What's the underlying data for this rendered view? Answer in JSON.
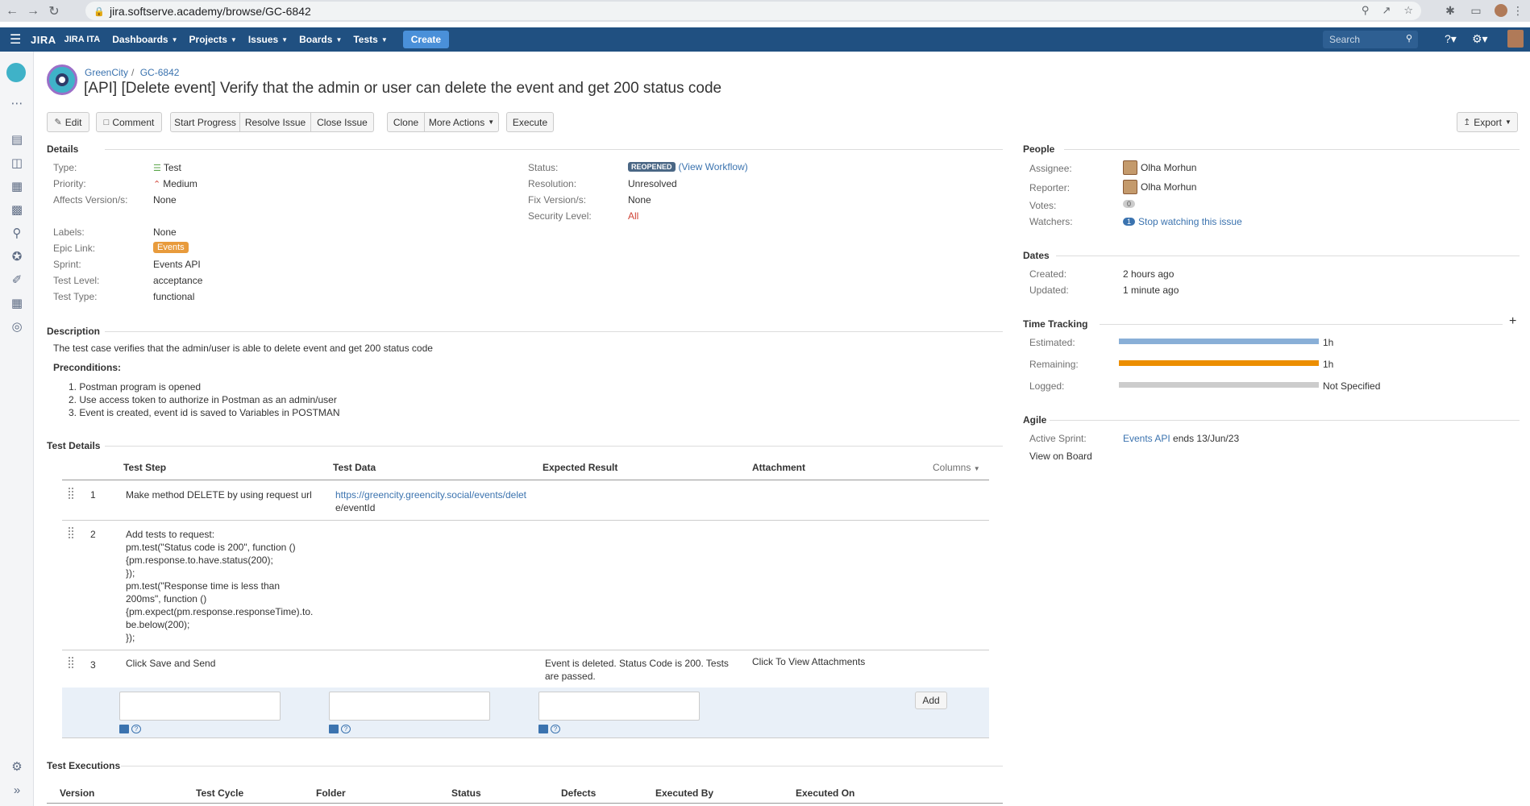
{
  "browser": {
    "url": "jira.softserve.academy/browse/GC-6842"
  },
  "header": {
    "logo": "JIRA",
    "instance": "JIRA ITA",
    "nav": [
      "Dashboards",
      "Projects",
      "Issues",
      "Boards",
      "Tests"
    ],
    "create": "Create",
    "search_placeholder": "Search"
  },
  "breadcrumbs": {
    "project": "GreenCity",
    "issue_key": "GC-6842"
  },
  "title": "[API] [Delete event] Verify that the admin or user can delete the event and get 200 status code",
  "toolbar": {
    "edit": "Edit",
    "comment": "Comment",
    "start_progress": "Start Progress",
    "resolve": "Resolve Issue",
    "close": "Close Issue",
    "clone": "Clone",
    "more": "More Actions",
    "execute": "Execute",
    "export": "Export"
  },
  "details": {
    "title": "Details",
    "left": [
      {
        "label": "Type:",
        "value": "Test"
      },
      {
        "label": "Priority:",
        "value": "Medium"
      },
      {
        "label": "Affects Version/s:",
        "value": "None"
      },
      {
        "label": "Labels:",
        "value": "None"
      },
      {
        "label": "Epic Link:",
        "value": "Events"
      },
      {
        "label": "Sprint:",
        "value": "Events API"
      },
      {
        "label": "Test Level:",
        "value": "acceptance"
      },
      {
        "label": "Test Type:",
        "value": "functional"
      }
    ],
    "right": [
      {
        "label": "Status:",
        "value": "REOPENED",
        "extra": "(View Workflow)"
      },
      {
        "label": "Resolution:",
        "value": "Unresolved"
      },
      {
        "label": "Fix Version/s:",
        "value": "None"
      },
      {
        "label": "Security Level:",
        "value": "All"
      }
    ]
  },
  "description": {
    "title": "Description",
    "text": "The test case verifies that the admin/user is able to delete event and get 200 status code",
    "preconditions_title": "Preconditions:",
    "preconditions": [
      "1. Postman program is opened",
      "2. Use access token to authorize in Postman as an admin/user",
      "3. Event is created, event id is saved to Variables in POSTMAN"
    ]
  },
  "test_details": {
    "title": "Test Details",
    "columns": [
      "Test Step",
      "Test Data",
      "Expected Result",
      "Attachment"
    ],
    "columns_button": "Columns",
    "rows": [
      {
        "num": "1",
        "step": [
          "Make method DELETE by using request url"
        ],
        "data": [
          "https://greencity.greencity.social/events/delet",
          "e/eventId"
        ],
        "expected": [],
        "attachment": ""
      },
      {
        "num": "2",
        "step": [
          "Add tests to request:",
          "pm.test(\"Status code is 200\", function ()",
          "{pm.response.to.have.status(200);",
          "});",
          "pm.test(\"Response time is less than",
          "200ms\", function ()",
          "{pm.expect(pm.response.responseTime).to.",
          "be.below(200);",
          "});"
        ],
        "data": [],
        "expected": [],
        "attachment": ""
      },
      {
        "num": "3",
        "step": [
          "Click Save and Send"
        ],
        "data": [],
        "expected": [
          "Event is deleted. Status Code is 200. Tests",
          "are passed."
        ],
        "attachment": "Click To View Attachments"
      }
    ],
    "add_button": "Add"
  },
  "executions": {
    "title": "Test Executions",
    "columns": [
      "Version",
      "Test Cycle",
      "Folder",
      "Status",
      "Defects",
      "Executed By",
      "Executed On"
    ]
  },
  "people": {
    "title": "People",
    "assignee_label": "Assignee:",
    "assignee": "Olha Morhun",
    "reporter_label": "Reporter:",
    "reporter": "Olha Morhun",
    "votes_label": "Votes:",
    "votes": "0",
    "watchers_label": "Watchers:",
    "watchers_count": "1",
    "watch_link": "Stop watching this issue"
  },
  "dates": {
    "title": "Dates",
    "created_label": "Created:",
    "created": "2 hours ago",
    "updated_label": "Updated:",
    "updated": "1 minute ago"
  },
  "time_tracking": {
    "title": "Time Tracking",
    "estimated_label": "Estimated:",
    "estimated": "1h",
    "estimated_fraction": 1.0,
    "remaining_label": "Remaining:",
    "remaining": "1h",
    "remaining_fraction": 1.0,
    "logged_label": "Logged:",
    "logged": "Not Specified",
    "logged_fraction": 0.0,
    "colors": {
      "estimated": "#89afd7",
      "remaining": "#ec8e00",
      "logged": "#cccccc"
    }
  },
  "agile": {
    "title": "Agile",
    "active_sprint_label": "Active Sprint:",
    "sprint": "Events API",
    "sprint_end": "ends 13/Jun/23",
    "view_board": "View on Board"
  }
}
